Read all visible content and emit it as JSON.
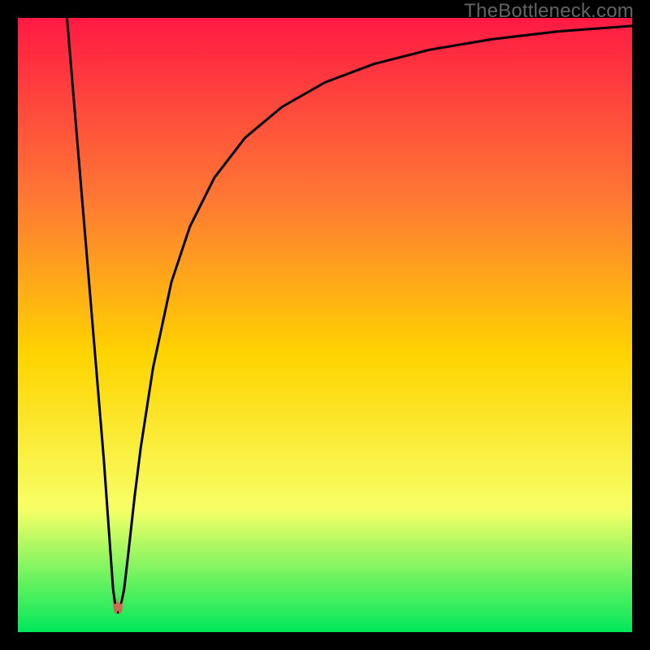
{
  "watermark": "TheBottleneck.com",
  "chart_data": {
    "type": "line",
    "title": "",
    "xlabel": "",
    "ylabel": "",
    "xlim": [
      0,
      100
    ],
    "ylim": [
      0,
      100
    ],
    "background_gradient": {
      "top": "#ff1a44",
      "upper_mid": "#ff7a33",
      "mid": "#ffd400",
      "lower_mid": "#f7ff66",
      "bottom": "#00e85b"
    },
    "series": [
      {
        "name": "bottleneck-curve",
        "color": "#000000",
        "x": [
          8.0,
          9.0,
          10.0,
          11.0,
          12.0,
          13.0,
          14.0,
          15.0,
          15.5,
          16.0,
          16.3,
          16.6,
          17.3,
          18.0,
          19.0,
          20.0,
          22.0,
          25.0,
          28.0,
          32.0,
          37.0,
          43.0,
          50.0,
          58.0,
          67.0,
          77.0,
          88.0,
          100.0
        ],
        "y": [
          100.0,
          88.0,
          76.0,
          64.0,
          52.0,
          40.0,
          28.0,
          14.0,
          7.0,
          3.5,
          3.2,
          3.5,
          7.0,
          13.0,
          22.0,
          30.0,
          43.0,
          57.0,
          66.0,
          74.0,
          80.5,
          85.5,
          89.5,
          92.5,
          94.8,
          96.5,
          97.8,
          98.7
        ]
      }
    ],
    "marker": {
      "name": "minimum-marker",
      "color": "#c86a53",
      "x_range": [
        15.4,
        17.2
      ],
      "y_range": [
        3.0,
        6.2
      ]
    }
  }
}
